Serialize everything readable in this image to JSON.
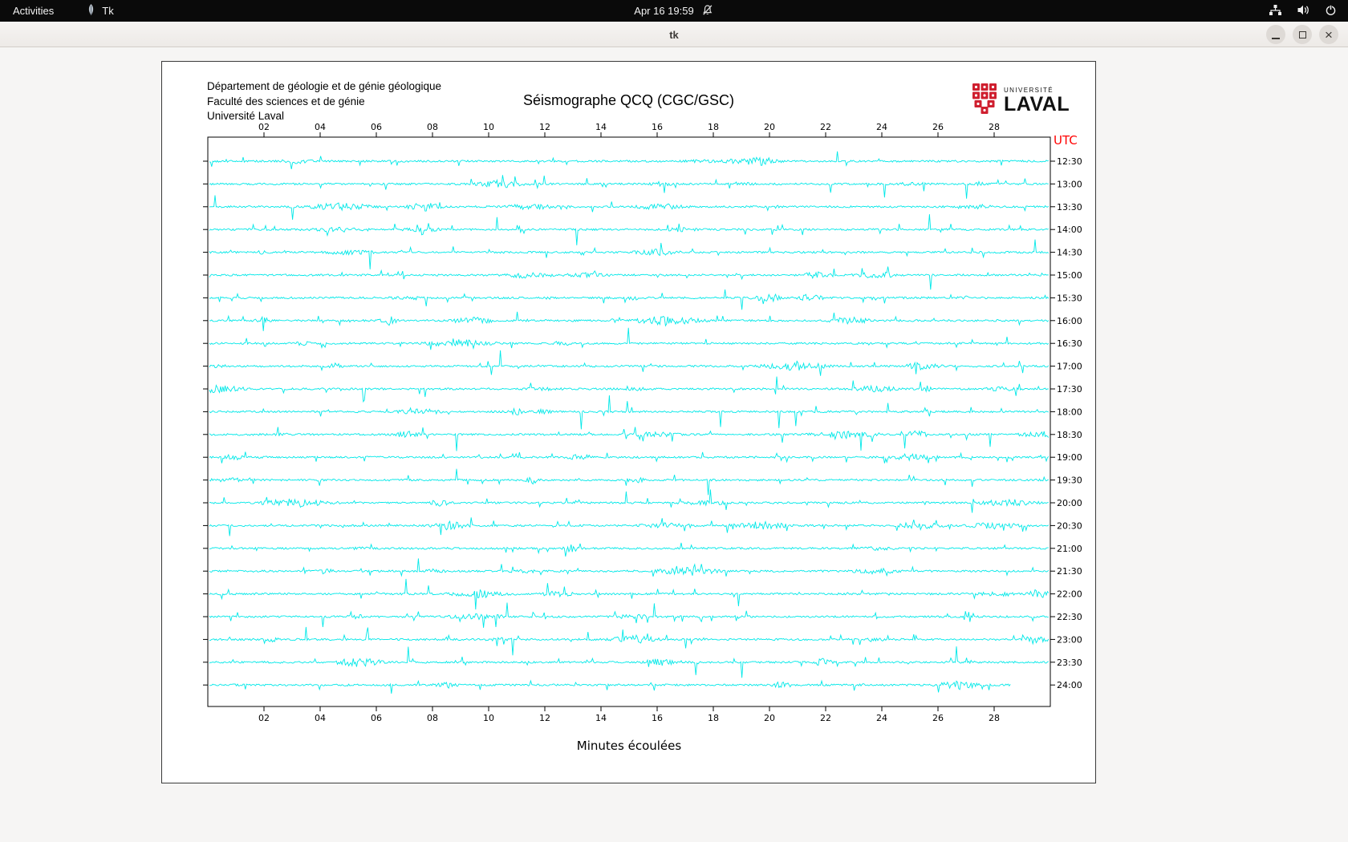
{
  "topbar": {
    "activities": "Activities",
    "app_name": "Tk",
    "clock": "Apr 16 19:59",
    "icons": {
      "app": "tk-feather",
      "notifications": "bell-muted",
      "network": "network-nodes",
      "volume": "speaker",
      "power": "power"
    }
  },
  "window": {
    "title": "tk"
  },
  "header": {
    "dept_lines": [
      "Département de géologie et de génie géologique",
      "Faculté des sciences et de génie",
      "Université Laval"
    ],
    "title": "Séismographe QCQ (CGC/GSC)",
    "logo_small": "UNIVERSITÉ",
    "logo_large": "LAVAL"
  },
  "plot": {
    "utc_label": "UTC",
    "xlabel": "Minutes écoulées",
    "x_ticks": [
      "02",
      "04",
      "06",
      "08",
      "10",
      "12",
      "14",
      "16",
      "18",
      "20",
      "22",
      "24",
      "26",
      "28"
    ],
    "x_tick_minutes": [
      2,
      4,
      6,
      8,
      10,
      12,
      14,
      16,
      18,
      20,
      22,
      24,
      26,
      28
    ],
    "x_range_minutes": [
      0,
      30
    ],
    "row_labels": [
      "12:30",
      "13:00",
      "13:30",
      "14:00",
      "14:30",
      "15:00",
      "15:30",
      "16:00",
      "16:30",
      "17:00",
      "17:30",
      "18:00",
      "18:30",
      "19:00",
      "19:30",
      "20:00",
      "20:30",
      "21:00",
      "21:30",
      "22:00",
      "22:30",
      "23:00",
      "23:30",
      "24:00"
    ],
    "colors": {
      "trace": "#00e8e8",
      "utc": "#ff0000",
      "axis": "#000000",
      "logo_red": "#cf1f2f"
    }
  }
}
